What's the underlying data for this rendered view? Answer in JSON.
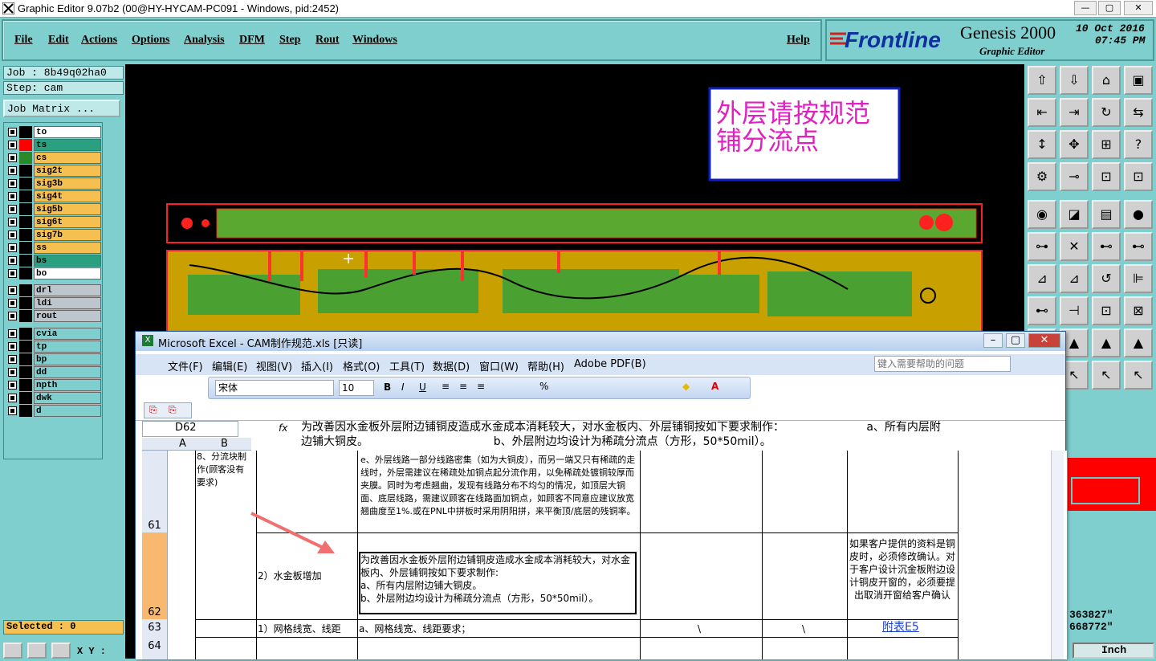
{
  "titlebar": {
    "title": "Graphic Editor 9.07b2 (00@HY-HYCAM-PC091 - Windows, pid:2452)",
    "min": "—",
    "max": "▢",
    "close": "✕"
  },
  "menu": {
    "items": [
      "File",
      "Edit",
      "Actions",
      "Options",
      "Analysis",
      "DFM",
      "Step",
      "Rout",
      "Windows"
    ],
    "help": "Help"
  },
  "brand": {
    "logo": "Frontline",
    "product": "Genesis 2000",
    "subtitle": "Graphic Editor",
    "date": "10 Oct 2016",
    "time": "07:45 PM"
  },
  "left": {
    "job": "Job : 8b49q02ha0",
    "step": "Step: cam",
    "matrix_button": "Job Matrix ...",
    "selected": "Selected : 0",
    "xy": "X Y :"
  },
  "layers": [
    {
      "name": "to",
      "color": "#ffffff",
      "swatch": "#000000"
    },
    {
      "name": "ts",
      "color": "#2aa080",
      "swatch": "#ff0000"
    },
    {
      "name": "cs",
      "color": "#f6c050",
      "swatch": "#2a8a2a"
    },
    {
      "name": "sig2t",
      "color": "#f6c050",
      "swatch": "#000000"
    },
    {
      "name": "sig3b",
      "color": "#f6c050",
      "swatch": "#000000"
    },
    {
      "name": "sig4t",
      "color": "#f6c050",
      "swatch": "#000000"
    },
    {
      "name": "sig5b",
      "color": "#f6c050",
      "swatch": "#000000"
    },
    {
      "name": "sig6t",
      "color": "#f6c050",
      "swatch": "#000000"
    },
    {
      "name": "sig7b",
      "color": "#f6c050",
      "swatch": "#000000"
    },
    {
      "name": "ss",
      "color": "#f6c050",
      "swatch": "#000000"
    },
    {
      "name": "bs",
      "color": "#2aa080",
      "swatch": "#000000"
    },
    {
      "name": "bo",
      "color": "#ffffff",
      "swatch": "#000000"
    }
  ],
  "layers2": [
    {
      "name": "drl",
      "color": "#bcc6cc"
    },
    {
      "name": "ldi",
      "color": "#bcc6cc"
    },
    {
      "name": "rout",
      "color": "#bcc6cc"
    }
  ],
  "layers3": [
    {
      "name": "cvia"
    },
    {
      "name": "tp"
    },
    {
      "name": "bp"
    },
    {
      "name": "dd"
    },
    {
      "name": "npth"
    },
    {
      "name": "dwk"
    },
    {
      "name": "d"
    }
  ],
  "annotation": {
    "line1": "外层请按规范",
    "line2": "铺分流点"
  },
  "readout": {
    "x": "363827\"",
    "y": "668772\"",
    "unit": "Inch"
  },
  "excel": {
    "title": "Microsoft Excel - CAM制作规范.xls  [只读]",
    "menu": [
      "文件(F)",
      "编辑(E)",
      "视图(V)",
      "插入(I)",
      "格式(O)",
      "工具(T)",
      "数据(D)",
      "窗口(W)",
      "帮助(H)",
      "Adobe PDF(B)"
    ],
    "help_placeholder": "键入需要帮助的问题",
    "font": "宋体",
    "size": "10",
    "cellref": "D62",
    "fx": "fx",
    "formula_line1": "为改善因水金板外层附边铺铜皮造成水金成本消耗较大，对水金板内、外层铺铜按如下要求制作：                       a、所有内层附",
    "formula_line2": "边铺大铜皮。                                   b、外层附边均设计为稀疏分流点（方形，50*50mil）。",
    "col_headers": [
      "A",
      "B"
    ],
    "rows": [
      "61",
      "62",
      "63",
      "64"
    ],
    "b61": "8、分流块制作(顾客没有要求)",
    "d61": "e、外层线路一部分线路密集（如为大铜皮），而另一端又只有稀疏的走线时，外层需建议在稀疏处加铜点起分流作用，以免稀疏处镀铜较厚而夹膜。同时为考虑翘曲，发现有线路分布不均匀的情况，如顶层大铜面、底层线路，需建议顾客在线路面加铜点，如顾客不同意应建议放宽翘曲度至1%.或在PNL中拼板时采用阴阳拼，来平衡顶/底层的残铜率。",
    "c62": "2）水金板增加",
    "d62": "为改善因水金板外层附边铺铜皮造成水金成本消耗较大，对水金板内、外层铺铜按如下要求制作:\na、所有内层附边铺大铜皮。\nb、外层附边均设计为稀疏分流点（方形，50*50mil）。",
    "g62": "如果客户提供的资料是铜皮时，必须修改确认。对于客户设计沉金板附边设计铜皮开窗的，必须要提出取消开窗给客户确认",
    "c63": "1）网格线宽、线距",
    "d63": "a、网格线宽、线距要求；",
    "e63": "\\",
    "f63": "\\",
    "g63": "附表E5"
  }
}
